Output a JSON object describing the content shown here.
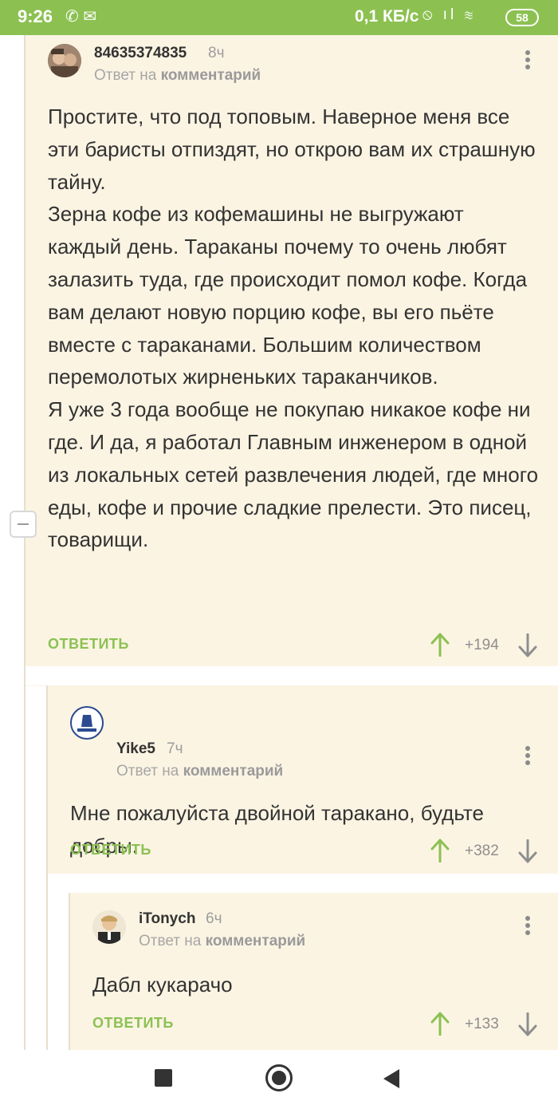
{
  "status_bar": {
    "time": "9:26",
    "left_icons": "✆ ✉",
    "network_speed": "0,1 КБ/с",
    "right_icons": "⦸ ıl ≋",
    "battery": "58"
  },
  "thread": {
    "reply_to_prefix": "Ответ на",
    "reply_to_target": "комментарий",
    "reply_label": "ОТВЕТИТЬ"
  },
  "comments": [
    {
      "username": "84635374835",
      "time": "8ч",
      "text": [
        "Простите, что под топовым. Наверное меня все эти баристы отпиздят, но открою вам их страшную тайну.",
        "Зерна кофе из кофемашины не выгружают каждый день. Тараканы почему то очень любят залазить туда, где происходит помол кофе. Когда вам делают новую порцию кофе, вы его пьёте вместе с тараканами. Большим количеством перемолотых жирненьких тараканчиков.",
        "Я уже 3 года вообще не покупаю никакое кофе ни где. И да, я работал Главным инженером в одной из локальных сетей развлечения людей, где много еды, кофе и прочие сладкие прелести. Это писец, товарищи."
      ],
      "rating": "+194"
    },
    {
      "username": "Yike5",
      "time": "7ч",
      "text": [
        "Мне пожалуйста двойной таракано, будьте добры."
      ],
      "rating": "+382"
    },
    {
      "username": "iTonych",
      "time": "6ч",
      "text": [
        "Дабл кукарачо"
      ],
      "rating": "+133"
    }
  ],
  "colors": {
    "status_bar": "#8cc152",
    "comment_bg": "#fbf4e3",
    "accent_green": "#8cc152",
    "text": "#333333",
    "muted": "#9d9d9d"
  },
  "icons": {
    "vote_up": "arrow-up-icon",
    "vote_down": "arrow-down-icon",
    "menu": "more-vert-icon",
    "collapse": "minus-icon"
  }
}
